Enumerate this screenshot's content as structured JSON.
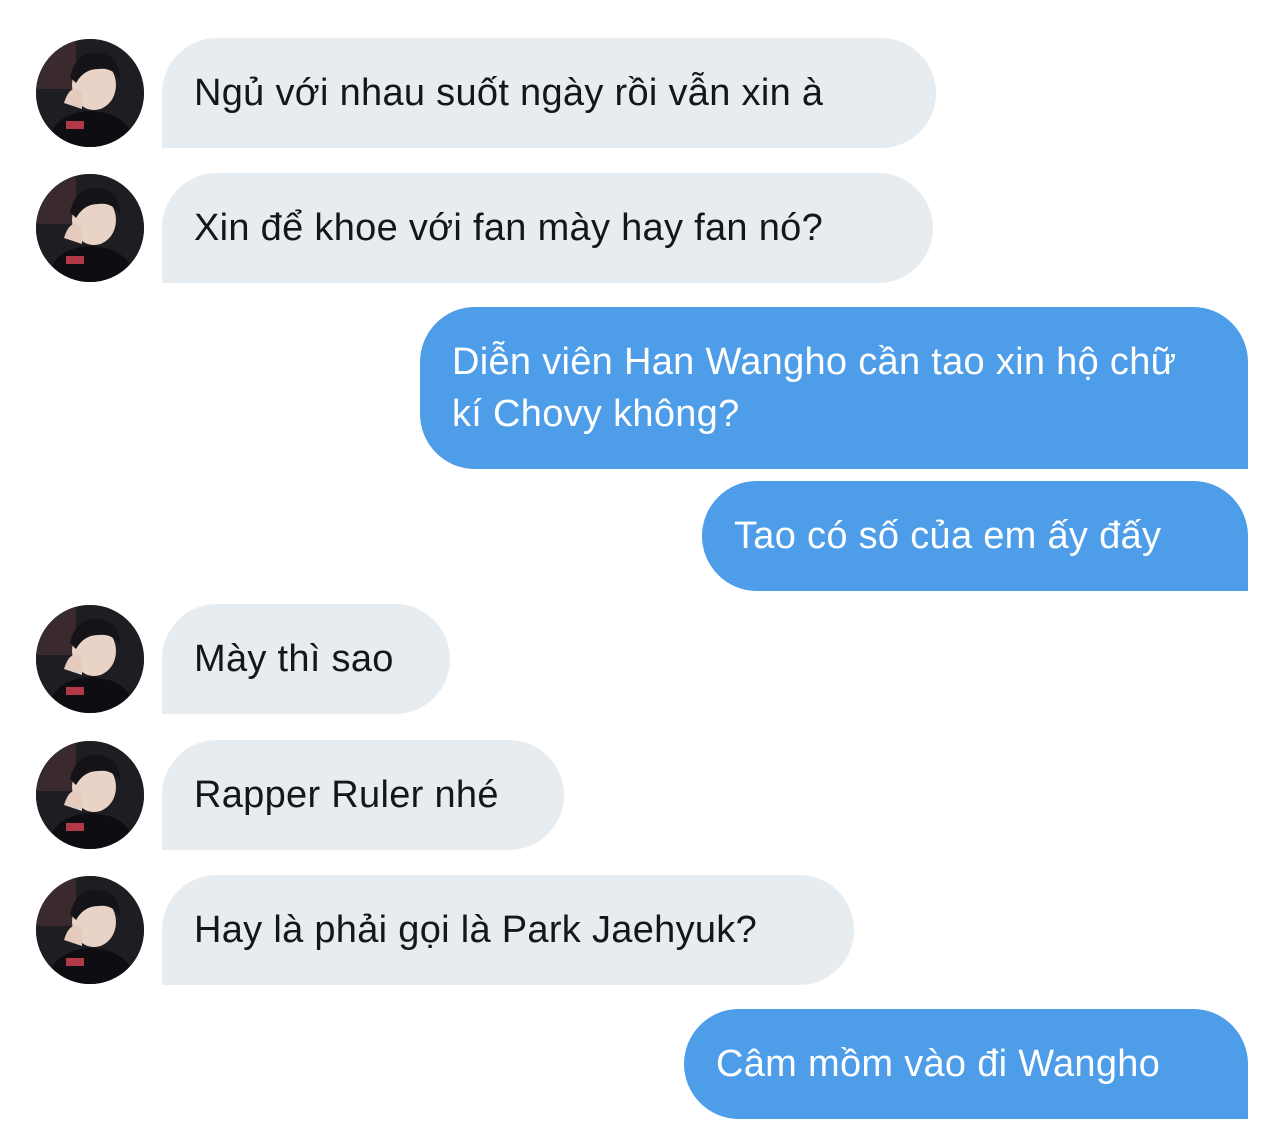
{
  "conversation": {
    "messages": [
      {
        "sender": "other",
        "text": "Ngủ với nhau suốt ngày rồi vẫn xin à"
      },
      {
        "sender": "other",
        "text": "Xin để khoe với fan mày hay fan nó?"
      },
      {
        "sender": "me",
        "text": "Diễn viên Han Wangho cần tao xin hộ chữ kí Chovy không?"
      },
      {
        "sender": "me",
        "text": "Tao có số của em ấy đấy"
      },
      {
        "sender": "other",
        "text": "Mày thì sao"
      },
      {
        "sender": "other",
        "text": "Rapper Ruler nhé"
      },
      {
        "sender": "other",
        "text": "Hay là phải gọi là Park Jaehyuk?"
      },
      {
        "sender": "me",
        "text": "Câm mồm vào đi Wangho"
      }
    ]
  },
  "colors": {
    "incoming_bubble": "#e6ecf0",
    "incoming_text": "#14171a",
    "outgoing_bubble": "#4d9de9",
    "outgoing_text": "#ffffff",
    "background": "#ffffff"
  },
  "icons": {
    "avatar": "profile-photo-avatar-icon"
  }
}
